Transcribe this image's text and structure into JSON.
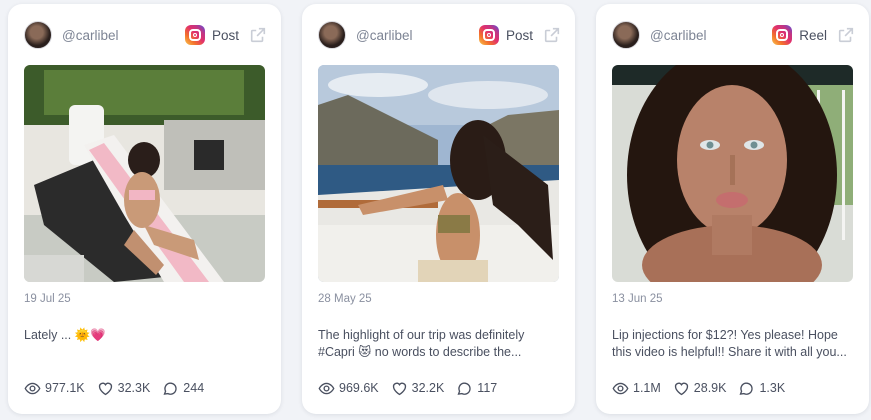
{
  "posts": [
    {
      "handle": "@carlibel",
      "type": "Post",
      "date": "19 Jul 25",
      "caption_lines": [
        "Lately ... 🌞💗"
      ],
      "views": "977.1K",
      "likes": "32.3K",
      "comments": "244"
    },
    {
      "handle": "@carlibel",
      "type": "Post",
      "date": "28 May 25",
      "caption_lines": [
        "The highlight of our trip was definitely",
        "#Capri 😻 no words to describe the..."
      ],
      "views": "969.6K",
      "likes": "32.2K",
      "comments": "117"
    },
    {
      "handle": "@carlibel",
      "type": "Reel",
      "date": "13 Jun 25",
      "caption_lines": [
        "Lip injections for $12?! Yes please! Hope",
        "this video is helpful!! Share it with all you..."
      ],
      "views": "1.1M",
      "likes": "28.9K",
      "comments": "1.3K"
    }
  ],
  "icons": {
    "platform": "instagram-icon",
    "open": "external-link-icon",
    "views": "eye-icon",
    "likes": "heart-icon",
    "comments": "comment-icon"
  },
  "colors": {
    "background": "#f1f3f7",
    "card": "#ffffff",
    "muted_text": "#8a90a0"
  }
}
